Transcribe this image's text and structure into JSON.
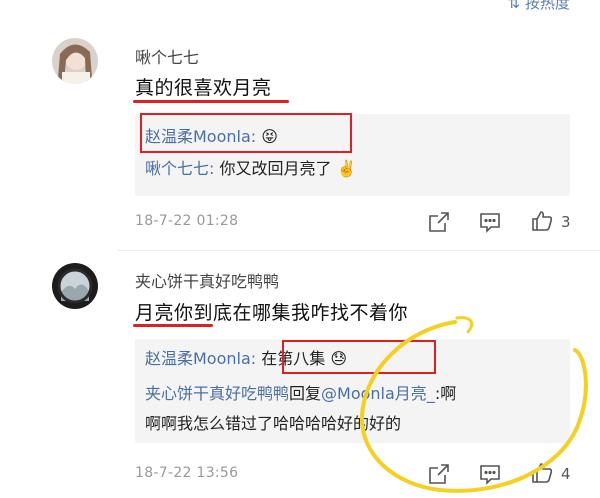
{
  "header": {
    "sort_label": "按热度"
  },
  "comments": [
    {
      "username": "啾个七七",
      "text": "真的很喜欢月亮",
      "replies": [
        {
          "author": "赵温柔Moonla",
          "sep": ":",
          "body": "",
          "emoji": "😝"
        },
        {
          "author": "啾个七七",
          "sep": ":",
          "body": " 你又改回月亮了",
          "emoji": "✌️"
        }
      ],
      "timestamp": "18-7-22 01:28",
      "likes": "3"
    },
    {
      "username": "夹心饼干真好吃鸭鸭",
      "text": "月亮你到底在哪集我咋找不着你",
      "replies": [
        {
          "author": "赵温柔Moonla",
          "sep": ":",
          "body": " 在第八集",
          "emoji": "😓"
        },
        {
          "author": "夹心饼干真好吃鸭鸭",
          "mid": "回复",
          "mention": "@Moonla月亮_",
          "body": ":啊",
          "body2": "啊啊我怎么错过了哈哈哈哈好的好的"
        }
      ],
      "timestamp": "18-7-22 13:56",
      "likes": "4"
    }
  ],
  "colors": {
    "link": "#4a6fa5",
    "annotation_red": "#e02020",
    "annotation_yellow": "#f5d020"
  },
  "icons": [
    "share-icon",
    "comment-icon",
    "thumbs-up-icon"
  ]
}
